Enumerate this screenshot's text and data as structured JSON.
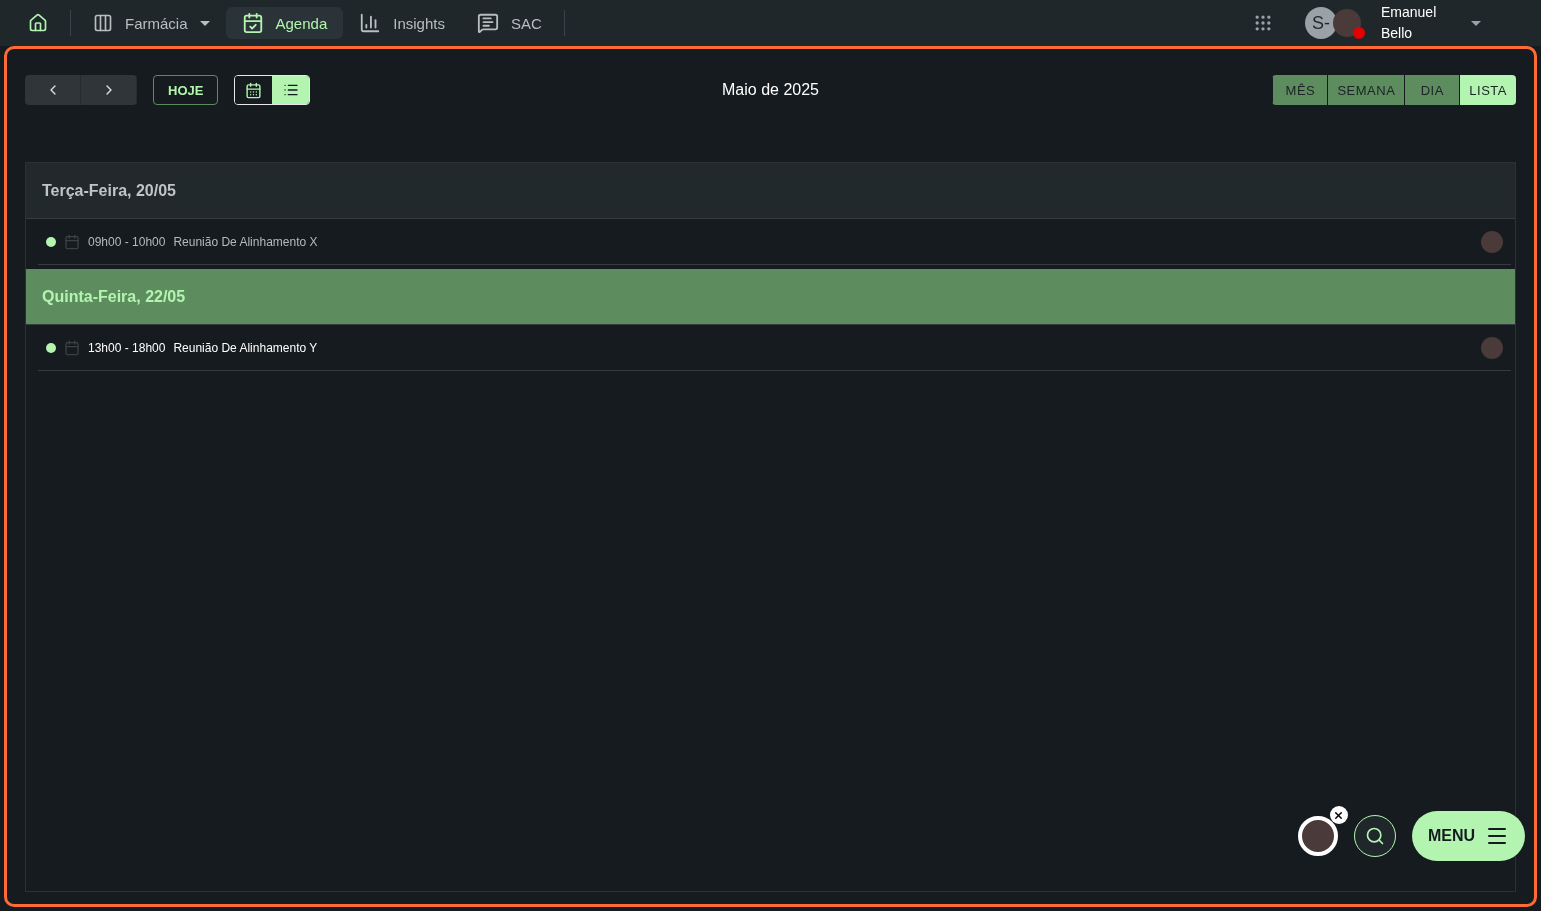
{
  "nav": {
    "items": [
      {
        "kind": "dropdown",
        "label": "Farmácia",
        "selected": false
      },
      {
        "kind": "calendar",
        "label": "Agenda",
        "selected": true
      },
      {
        "kind": "chart",
        "label": "Insights",
        "selected": false
      },
      {
        "kind": "chat",
        "label": "SAC",
        "selected": false
      }
    ]
  },
  "user": {
    "initials": "S-",
    "first_name": "Emanuel",
    "last_name": "Bello"
  },
  "toolbar": {
    "today": "HOJE",
    "title": "Maio de 2025",
    "layout_toggle": [
      {
        "kind": "calendar",
        "selected": false
      },
      {
        "kind": "list",
        "selected": true
      }
    ],
    "views": [
      {
        "label": "MÊS",
        "selected": false
      },
      {
        "label": "SEMANA",
        "selected": false
      },
      {
        "label": "DIA",
        "selected": false
      },
      {
        "label": "LISTA",
        "selected": true
      }
    ]
  },
  "days": [
    {
      "title": "Terça-Feira, 20/05",
      "selected": false,
      "events": [
        {
          "time": "09h00 - 10h00",
          "title": "Reunião De Alinhamento X",
          "past": true
        }
      ]
    },
    {
      "title": "Quinta-Feira, 22/05",
      "selected": true,
      "events": [
        {
          "time": "13h00 - 18h00",
          "title": "Reunião De Alinhamento Y",
          "past": false
        }
      ]
    }
  ],
  "menu_button": "MENU"
}
